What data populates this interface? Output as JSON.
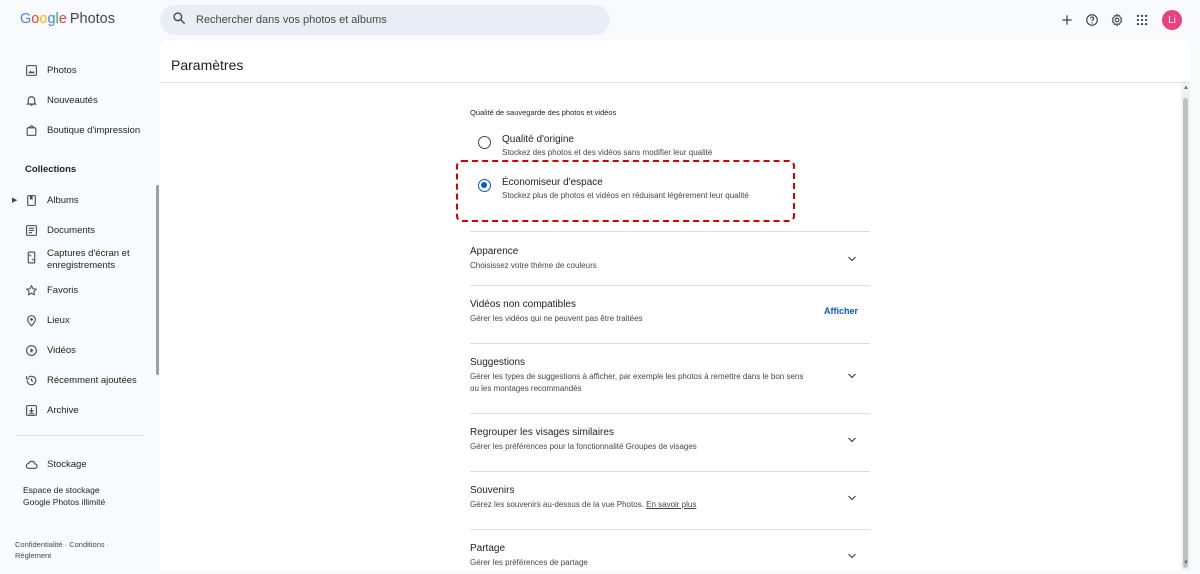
{
  "app": {
    "logo_word": "Google",
    "product": "Photos"
  },
  "search": {
    "placeholder": "Rechercher dans vos photos et albums"
  },
  "topbar": {
    "icons": [
      "add-icon",
      "help-icon",
      "settings-icon",
      "apps-grid-icon"
    ],
    "avatar_initials": "Li",
    "avatar_color": "#e8417f"
  },
  "sidebar": {
    "items": [
      {
        "label": "Photos",
        "icon": "photo-icon"
      },
      {
        "label": "Nouveautés",
        "icon": "bell-icon"
      },
      {
        "label": "Boutique d'impression",
        "icon": "shopping-bag-icon"
      }
    ],
    "collections_label": "Collections",
    "collections": [
      {
        "label": "Albums",
        "icon": "album-icon"
      },
      {
        "label": "Documents",
        "icon": "document-icon"
      },
      {
        "label": "Captures d'écran et",
        "label2": "enregistrements",
        "icon": "screenshot-icon"
      },
      {
        "label": "Favoris",
        "icon": "star-icon"
      },
      {
        "label": "Lieux",
        "icon": "location-pin-icon"
      },
      {
        "label": "Vidéos",
        "icon": "play-circle-icon"
      },
      {
        "label": "Récemment ajoutées",
        "icon": "history-icon"
      },
      {
        "label": "Archive",
        "icon": "archive-icon"
      }
    ],
    "storage_label": "Stockage",
    "storage_line1": "Espace de stockage",
    "storage_line2": "Google Photos illimité",
    "footer_line1": "Confidentialité  ·  Conditions  ·",
    "footer_line2": "Règlement"
  },
  "main": {
    "title": "Paramètres",
    "backup_heading": "Qualité de sauvegarde des photos et vidéos",
    "options": [
      {
        "title": "Qualité d'origine",
        "desc": "Stockez des photos et des vidéos sans modifier leur qualité",
        "checked": false
      },
      {
        "title": "Économiseur d'espace",
        "desc": "Stockez plus de photos et vidéos en réduisant légèrement leur qualité",
        "checked": true
      }
    ],
    "settings": [
      {
        "title": "Apparence",
        "desc": "Choisissez votre thème de couleurs"
      },
      {
        "title": "Vidéos non compatibles",
        "desc": "Gérer les vidéos qui ne peuvent pas être traitées",
        "action": "Afficher"
      },
      {
        "title": "Suggestions",
        "desc": "Gérer les types de suggestions à afficher, par exemple les photos à remettre dans le bon sens ou les montages recommandés"
      },
      {
        "title": "Regrouper les visages similaires",
        "desc": "Gérer les préférences pour la fonctionnalité Groupes de visages"
      },
      {
        "title": "Souvenirs",
        "desc": "Gérez les souvenirs au-dessus de la vue Photos.",
        "link": "En savoir plus"
      },
      {
        "title": "Partage",
        "desc": "Gérer les préférences de partage"
      }
    ]
  },
  "colors": {
    "accent": "#0b57d0",
    "highlight": "#d00000"
  }
}
